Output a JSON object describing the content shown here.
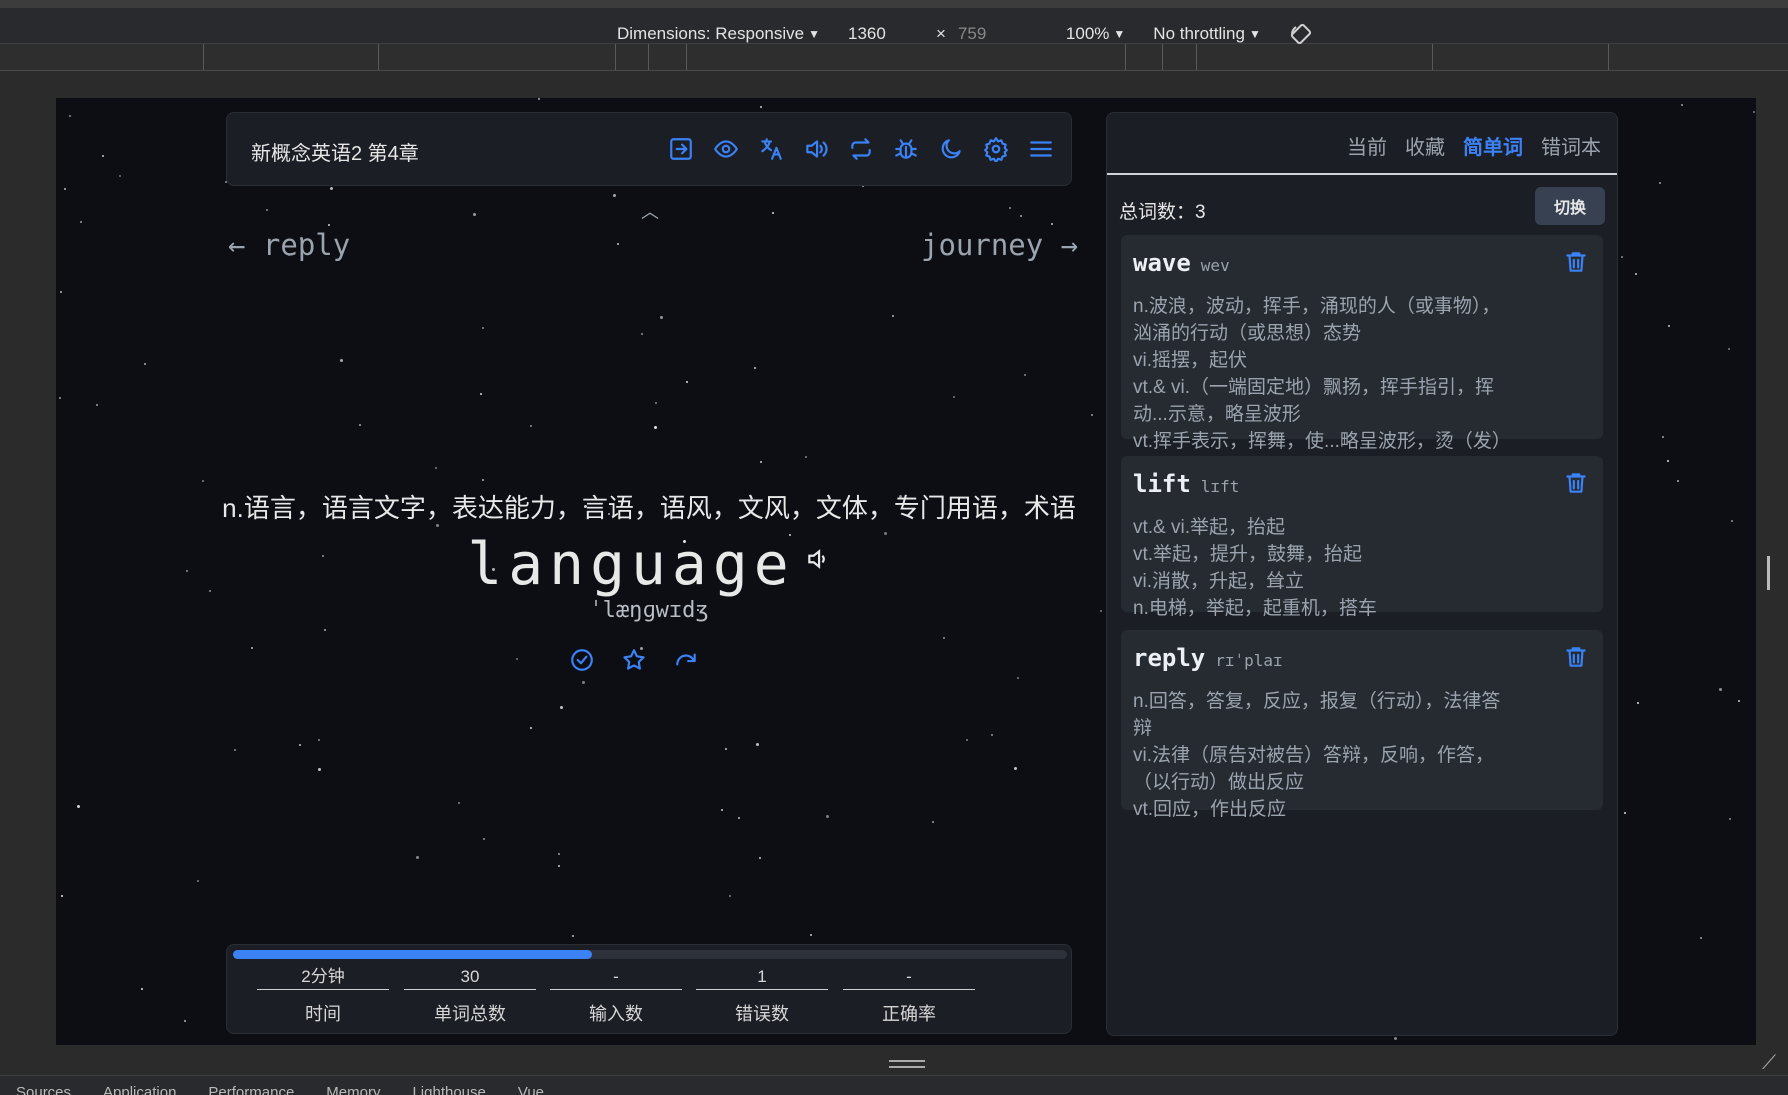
{
  "devtools": {
    "dimensions_label": "Dimensions: Responsive",
    "width": "1360",
    "times": "×",
    "height": "759",
    "zoom": "100%",
    "throttle": "No throttling",
    "rotate_icon": "rotate-icon",
    "tabs": [
      "Sources",
      "Application",
      "Performance",
      "Memory",
      "Lighthouse",
      "Vue"
    ]
  },
  "app": {
    "dict_title": "新概念英语2 第4章",
    "toolbar_icons": [
      "exit-icon",
      "eye-icon",
      "translate-icon",
      "speaker-icon",
      "repeat-icon",
      "bug-icon",
      "moon-icon",
      "gear-icon",
      "menu-icon"
    ],
    "nav": {
      "prev": "← reply",
      "next": "journey →"
    },
    "current": {
      "translation": "n.语言，语言文字，表达能力，言语，语风，文风，文体，专门用语，术语",
      "word": "language",
      "phonetic": "ˈlæŋɡwɪdʒ"
    },
    "stats": [
      {
        "value": "2分钟",
        "label": "时间"
      },
      {
        "value": "30",
        "label": "单词总数"
      },
      {
        "value": "-",
        "label": "输入数"
      },
      {
        "value": "1",
        "label": "错误数"
      },
      {
        "value": "-",
        "label": "正确率"
      }
    ],
    "progress": 0.43
  },
  "panel": {
    "tabs": [
      "当前",
      "收藏",
      "简单词",
      "错词本"
    ],
    "active_tab": "简单词",
    "total_label": "总词数：3",
    "switch_label": "切换",
    "cards": [
      {
        "word": "wave",
        "phonetic": "wev",
        "defs": [
          "n.波浪，波动，挥手，涌现的人（或事物），",
          "汹涌的行动（或思想）态势",
          "vi.摇摆，起伏",
          "vt.& vi.（一端固定地）飘扬，挥手指引，挥",
          "动...示意，略呈波形",
          "vt.挥手表示，挥舞，使...略呈波形，烫（发）"
        ]
      },
      {
        "word": "lift",
        "phonetic": "lɪft",
        "defs": [
          "vt.& vi.举起，抬起",
          "vt.举起，提升，鼓舞，抬起",
          "vi.消散，升起，耸立",
          "n.电梯，举起，起重机，搭车"
        ]
      },
      {
        "word": "reply",
        "phonetic": "rɪˈplaɪ",
        "defs": [
          "n.回答，答复，反应，报复（行动），法律答",
          "辩",
          "vi.法律（原告对被告）答辩，反响，作答，",
          "（以行动）做出反应",
          "vt.回应，作出反应"
        ]
      }
    ]
  },
  "side_button": "文A"
}
